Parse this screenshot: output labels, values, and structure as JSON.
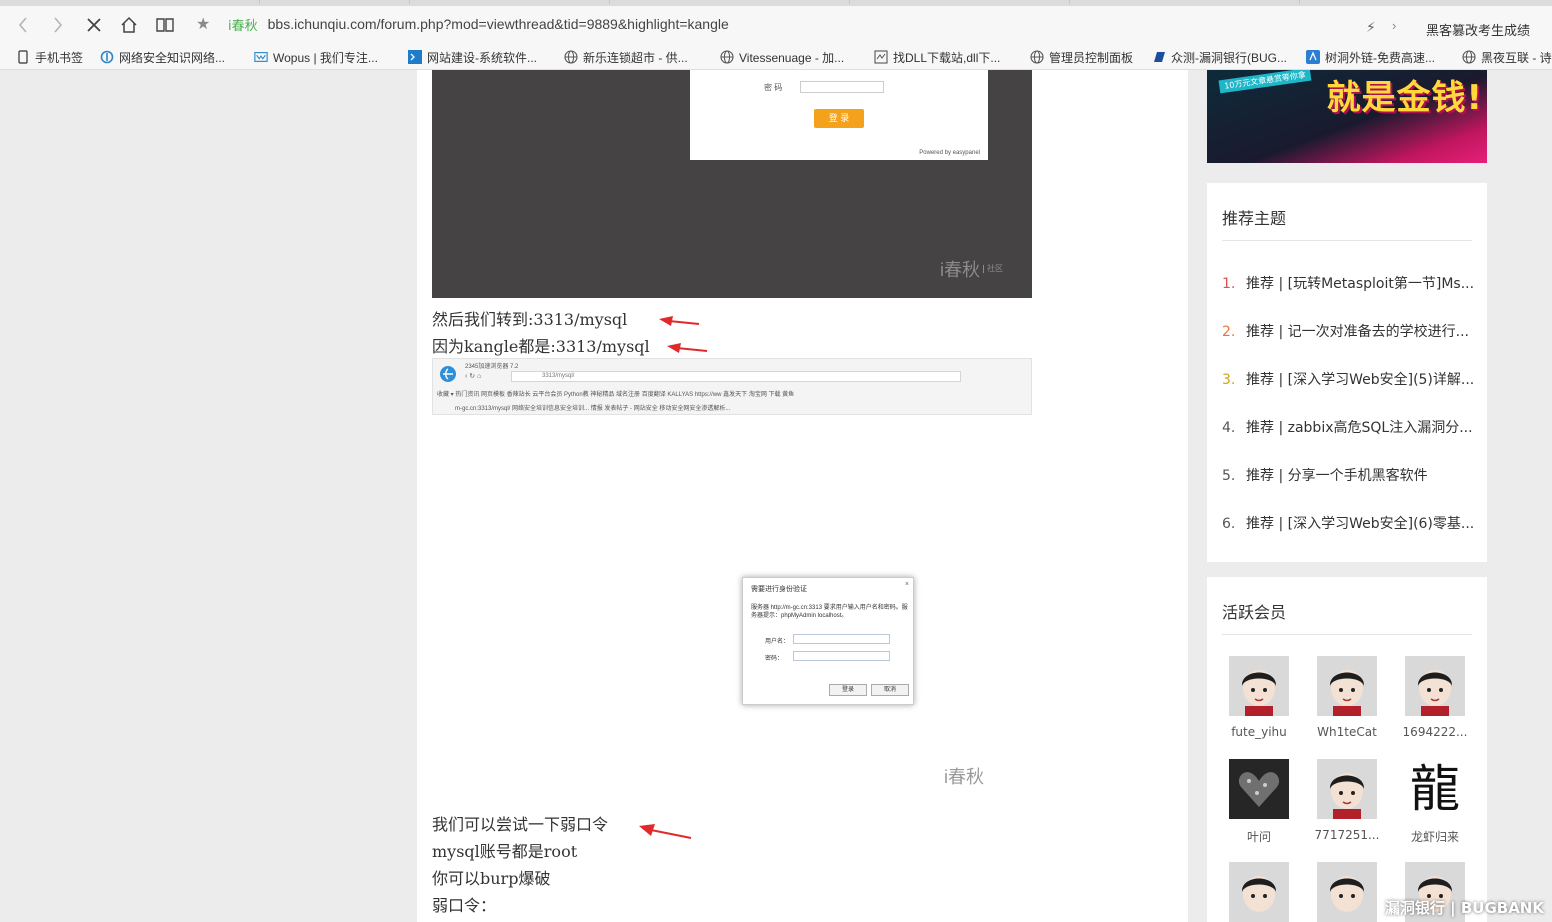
{
  "browser": {
    "url": "bbs.ichunqiu.com/forum.php?mod=viewthread&tid=9889&highlight=kangle",
    "site_badge": "i春秋",
    "search_text": "黑客篡改考生成绩"
  },
  "bookmarks": [
    {
      "label": "手机书签",
      "icon": "phone-icon"
    },
    {
      "label": "网络安全知识网络...",
      "icon": "ichunqiu-icon"
    },
    {
      "label": "Wopus | 我们专注...",
      "icon": "wopus-icon"
    },
    {
      "label": "网站建设-系统软件...",
      "icon": "terminal-icon"
    },
    {
      "label": "新乐连锁超市 - 供...",
      "icon": "globe-icon"
    },
    {
      "label": "Vitessenuage - 加...",
      "icon": "globe-icon"
    },
    {
      "label": "找DLL下载站,dll下...",
      "icon": "dll-icon"
    },
    {
      "label": "管理员控制面板",
      "icon": "globe-icon"
    },
    {
      "label": "众测-漏洞银行(BUG...",
      "icon": "bugbank-icon"
    },
    {
      "label": "树洞外链-免费高速...",
      "icon": "shudong-icon"
    },
    {
      "label": "黑夜互联 - 诗",
      "icon": "globe-icon"
    }
  ],
  "post": {
    "shot1": {
      "password_label": "密 码",
      "login_button": "登 录",
      "powered_by": "Powered by easypanel",
      "watermark": "i春秋",
      "watermark_sub": "社区"
    },
    "lines_a": [
      "然后我们转到:3313/mysql",
      "因为kangle都是:3313/mysql"
    ],
    "shot2": {
      "browser_title": "2345加速浏览器 7.2",
      "address": "3313/mysql/",
      "favorites": "收藏 ▾  热门资讯  网页模板  香辣站长  云平台会员  Python教  神秘精品  域名注册  百度翻译  KALLYAS  https://ww  鑫发天下  淘宝网  下载  黄鱼",
      "tabs": "m-gc.cn:3313/mysql/   网络安全培训信息安全培训...   情报   发表帖子 - 网站安全   移动安全网安全渗透解析..."
    },
    "auth_dialog": {
      "title": "需要进行身份验证",
      "info": "服务器 http://m-gc.cn:3313 要求用户输入用户名和密码。服务器提示：phpMyAdmin localhost。",
      "username_label": "用户名：",
      "password_label": "密码：",
      "ok_button": "登录",
      "cancel_button": "取消"
    },
    "watermark2": "i春秋",
    "lines_b": [
      "我们可以尝试一下弱口令",
      "mysql账号都是root",
      "你可以burp爆破",
      "弱口令："
    ]
  },
  "sidebar": {
    "ad": {
      "main_text": "就是金钱!",
      "sub_text": "10万元文章悬赏等你拿"
    },
    "recommended": {
      "title": "推荐主题",
      "items": [
        {
          "num": "1.",
          "text": "推荐 | [玩转Metasploit第一节]Ms..."
        },
        {
          "num": "2.",
          "text": "推荐 | 记一次对准备去的学校进行..."
        },
        {
          "num": "3.",
          "text": "推荐 | [深入学习Web安全](5)详解..."
        },
        {
          "num": "4.",
          "text": "推荐 | zabbix高危SQL注入漏洞分..."
        },
        {
          "num": "5.",
          "text": "推荐 | 分享一个手机黑客软件"
        },
        {
          "num": "6.",
          "text": "推荐 | [深入学习Web安全](6)零基..."
        }
      ],
      "num_colors": [
        "#d9534f",
        "#e8773a",
        "#d4a017",
        "#555555",
        "#555555",
        "#555555"
      ]
    },
    "members": {
      "title": "活跃会员",
      "items": [
        {
          "name": "fute_yihu",
          "avatar": "default-avatar"
        },
        {
          "name": "Wh1teCat",
          "avatar": "default-avatar"
        },
        {
          "name": "1694222...",
          "avatar": "default-avatar"
        },
        {
          "name": "叶问",
          "avatar": "dark-pattern-avatar"
        },
        {
          "name": "7717251...",
          "avatar": "default-avatar"
        },
        {
          "name": "龙虾归来",
          "avatar": "dragon-calligraphy-avatar"
        },
        {
          "name": "",
          "avatar": "default-avatar"
        },
        {
          "name": "",
          "avatar": "default-avatar"
        },
        {
          "name": "",
          "avatar": "default-avatar"
        }
      ],
      "dragon_glyph": "龍"
    }
  },
  "corner_watermark": "漏洞银行 | BUGBANK"
}
